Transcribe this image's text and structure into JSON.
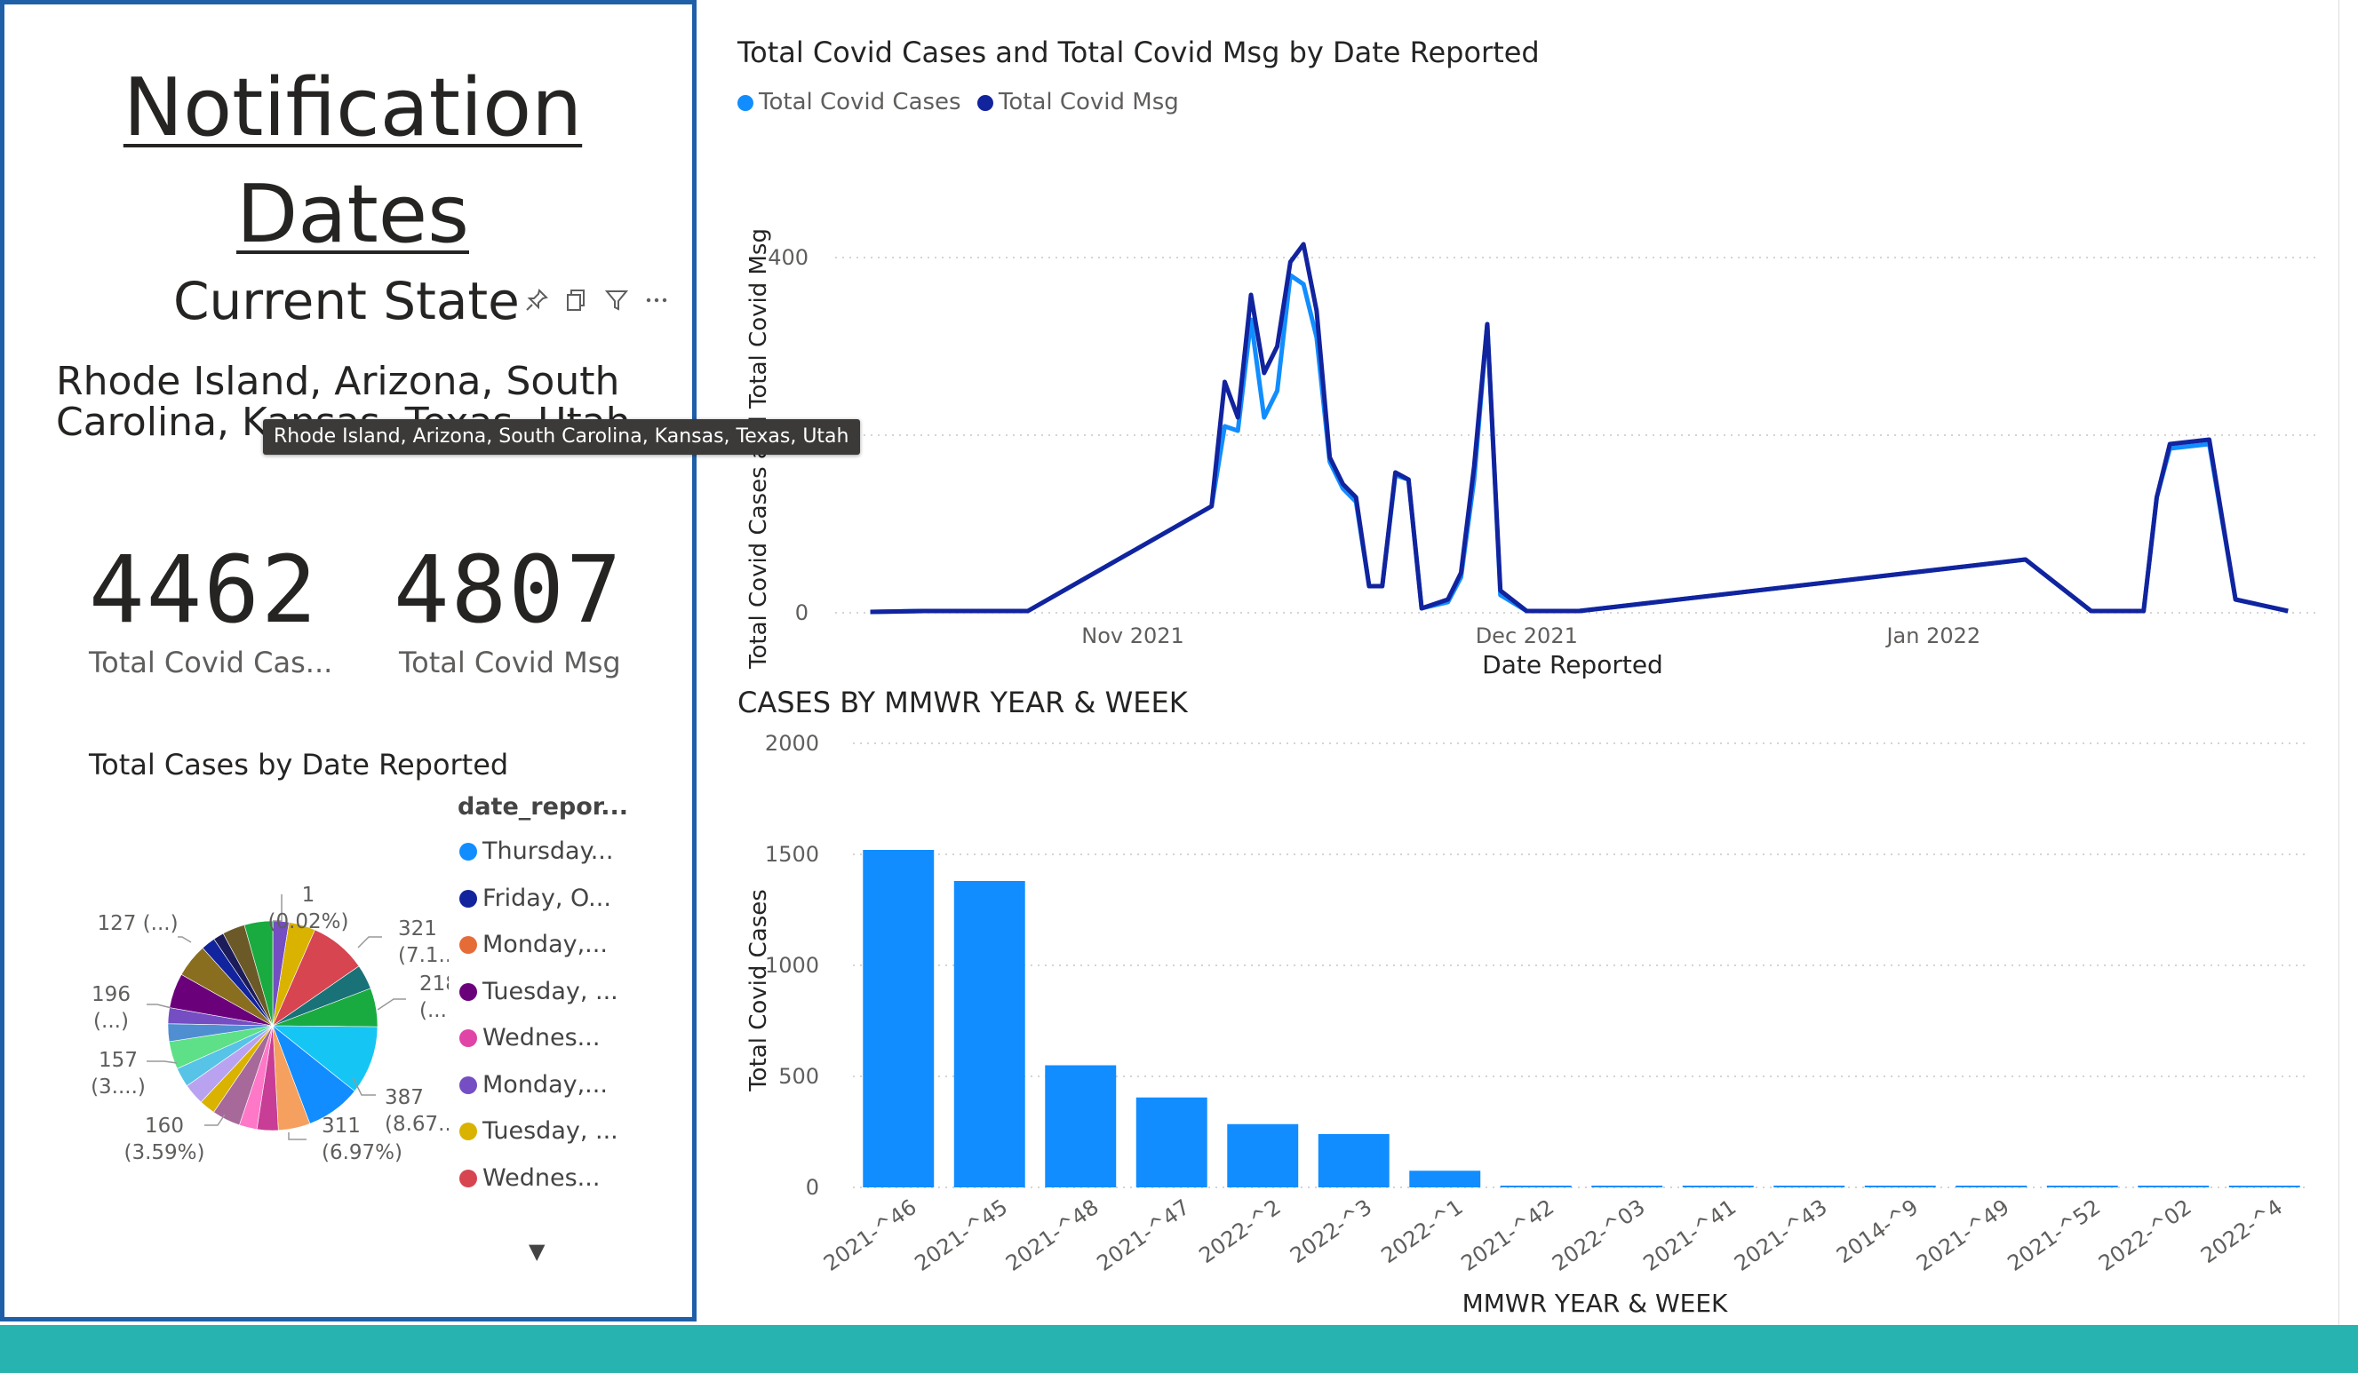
{
  "left_panel": {
    "title_line1": "Notification ",
    "title_line2": "Dates",
    "current_state_label": "Current State",
    "states_text": "Rhode Island, Arizona, South Carolina, Kansas, Texas, Utah",
    "tooltip": "Rhode Island, Arizona, South Carolina, Kansas, Texas, Utah",
    "toolbar_icons": [
      "pin-icon",
      "copy-icon",
      "filter-icon",
      "more-options-icon"
    ],
    "kpis": [
      {
        "value": "4462",
        "label": "Total Covid Cas..."
      },
      {
        "value": "4807",
        "label": "Total Covid Msg"
      }
    ],
    "pie_title": "Total Cases by Date Reported",
    "legend_title": "date_repor...",
    "legend_items": [
      {
        "label": "Thursday...",
        "color": "#118dff"
      },
      {
        "label": "Friday, O...",
        "color": "#12239e"
      },
      {
        "label": "Monday,...",
        "color": "#e66c37"
      },
      {
        "label": "Tuesday, ...",
        "color": "#6b007b"
      },
      {
        "label": "Wednes...",
        "color": "#e044a7"
      },
      {
        "label": "Monday,...",
        "color": "#744ec2"
      },
      {
        "label": "Tuesday, ...",
        "color": "#d9b300"
      },
      {
        "label": "Wednes...",
        "color": "#d64550"
      }
    ],
    "pie_labels": [
      {
        "line1": "1",
        "line2": "(0.02%)"
      },
      {
        "line1": "321",
        "line2": "(7.1...)"
      },
      {
        "line1": "218",
        "line2": "(...)"
      },
      {
        "line1": "387",
        "line2": "(8.67...)"
      },
      {
        "line1": "311",
        "line2": "(6.97%)"
      },
      {
        "line1": "160",
        "line2": "(3.59%)"
      },
      {
        "line1": "157",
        "line2": "(3....)"
      },
      {
        "line1": "196",
        "line2": "(...)"
      },
      {
        "line1": "127 (...)",
        "line2": ""
      }
    ]
  },
  "chart_data": [
    {
      "type": "pie",
      "title": "Total Cases by Date Reported",
      "legend_title": "date_repor...",
      "values": [
        1,
        90,
        150,
        321,
        140,
        218,
        387,
        311,
        180,
        120,
        100,
        160,
        90,
        120,
        110,
        157,
        100,
        90,
        196,
        190,
        80,
        60,
        127,
        160
      ],
      "colors": [
        "#d9b300",
        "#744ec2",
        "#d9b300",
        "#d64550",
        "#197278",
        "#1aab40",
        "#15c6f4",
        "#118dff",
        "#f5a05e",
        "#c83d95",
        "#ff77c7",
        "#a66999",
        "#d9b300",
        "#b9a3f1",
        "#57c3e6",
        "#5de087",
        "#4f8fd1",
        "#744ec2",
        "#6b007b",
        "#8a6e1f",
        "#12239e",
        "#1c1c5b",
        "#6b5a28",
        "#1aab40"
      ]
    },
    {
      "type": "line",
      "title": "Total Covid Cases and Total Covid Msg by Date Reported",
      "xlabel": "Date Reported",
      "ylabel": "Total Covid Cases and Total Covid Msg",
      "x_ticks": [
        "Nov 2021",
        "Dec 2021",
        "Jan 2022"
      ],
      "y_ticks": [
        0,
        400
      ],
      "ylim": [
        0,
        420
      ],
      "series": [
        {
          "name": "Total Covid Cases",
          "color": "#118dff",
          "x": [
            "2021-10-12",
            "2021-10-16",
            "2021-10-24",
            "2021-11-07",
            "2021-11-08",
            "2021-11-09",
            "2021-11-10",
            "2021-11-11",
            "2021-11-12",
            "2021-11-13",
            "2021-11-14",
            "2021-11-15",
            "2021-11-16",
            "2021-11-17",
            "2021-11-18",
            "2021-11-19",
            "2021-11-20",
            "2021-11-21",
            "2021-11-22",
            "2021-11-23",
            "2021-11-25",
            "2021-11-26",
            "2021-11-27",
            "2021-11-28",
            "2021-11-29",
            "2021-12-01",
            "2021-12-05",
            "2022-01-08",
            "2022-01-13",
            "2022-01-17",
            "2022-01-18",
            "2022-01-19",
            "2022-01-22",
            "2022-01-24",
            "2022-01-28"
          ],
          "y": [
            1,
            2,
            2,
            120,
            210,
            205,
            330,
            220,
            250,
            380,
            370,
            310,
            170,
            140,
            125,
            30,
            30,
            155,
            150,
            5,
            12,
            40,
            150,
            325,
            20,
            2,
            2,
            60,
            2,
            2,
            130,
            185,
            190,
            15,
            2
          ]
        },
        {
          "name": "Total Covid Msg",
          "color": "#12239e",
          "x": [
            "2021-10-12",
            "2021-10-16",
            "2021-10-24",
            "2021-11-07",
            "2021-11-08",
            "2021-11-09",
            "2021-11-10",
            "2021-11-11",
            "2021-11-12",
            "2021-11-13",
            "2021-11-14",
            "2021-11-15",
            "2021-11-16",
            "2021-11-17",
            "2021-11-18",
            "2021-11-19",
            "2021-11-20",
            "2021-11-21",
            "2021-11-22",
            "2021-11-23",
            "2021-11-25",
            "2021-11-26",
            "2021-11-27",
            "2021-11-28",
            "2021-11-29",
            "2021-12-01",
            "2021-12-05",
            "2022-01-08",
            "2022-01-13",
            "2022-01-17",
            "2022-01-18",
            "2022-01-19",
            "2022-01-22",
            "2022-01-24",
            "2022-01-28"
          ],
          "y": [
            1,
            2,
            2,
            120,
            260,
            220,
            358,
            270,
            300,
            395,
            415,
            340,
            175,
            145,
            130,
            30,
            30,
            158,
            150,
            5,
            15,
            45,
            165,
            325,
            25,
            2,
            2,
            60,
            2,
            2,
            130,
            190,
            195,
            15,
            2
          ]
        }
      ]
    },
    {
      "type": "bar",
      "title": "CASES BY MMWR YEAR & WEEK",
      "xlabel": "MMWR YEAR & WEEK",
      "ylabel": "Total Covid Cases",
      "categories": [
        "2021-^46",
        "2021-^45",
        "2021-^48",
        "2021-^47",
        "2022-^2",
        "2022-^3",
        "2022-^1",
        "2021-^42",
        "2022-^03",
        "2021-^41",
        "2021-^43",
        "2014-^9",
        "2021-^49",
        "2021-^52",
        "2022-^02",
        "2022-^4"
      ],
      "values": [
        1520,
        1380,
        550,
        405,
        285,
        240,
        75,
        4,
        3,
        3,
        3,
        2,
        2,
        2,
        2,
        2
      ],
      "y_ticks": [
        0,
        500,
        1000,
        1500,
        2000
      ],
      "ylim": [
        0,
        2000
      ],
      "color": "#118dff"
    }
  ]
}
